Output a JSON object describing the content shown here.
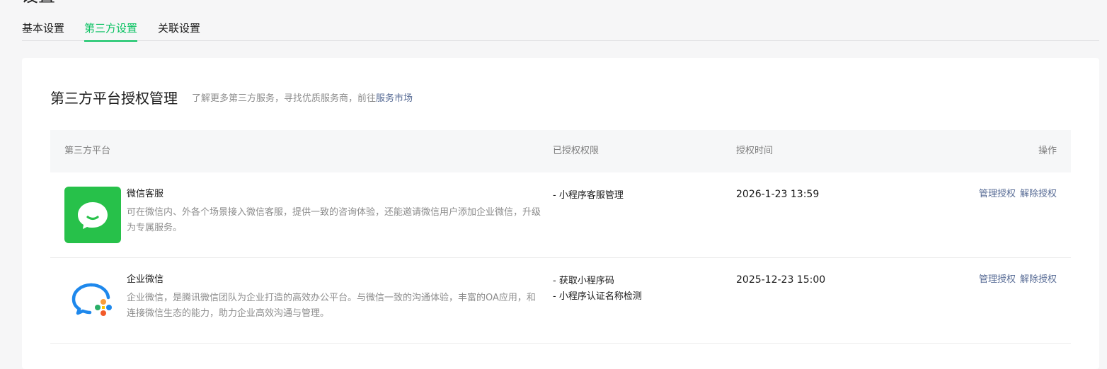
{
  "page": {
    "title": "设置"
  },
  "tabs": [
    {
      "label": "基本设置",
      "active": false
    },
    {
      "label": "第三方设置",
      "active": true
    },
    {
      "label": "关联设置",
      "active": false
    }
  ],
  "section": {
    "title": "第三方平台授权管理",
    "desc_prefix": "了解更多第三方服务，寻找优质服务商，前往",
    "desc_link": "服务市场"
  },
  "table": {
    "headers": {
      "platform": "第三方平台",
      "permissions": "已授权权限",
      "time": "授权时间",
      "action": "操作"
    },
    "rows": [
      {
        "icon": "wechat-kefu-icon",
        "name": "微信客服",
        "desc": "可在微信内、外各个场景接入微信客服，提供一致的咨询体验，还能邀请微信用户添加企业微信，升级为专属服务。",
        "permissions": [
          "- 小程序客服管理"
        ],
        "time": "2026-1-23 13:59",
        "manage": "管理授权",
        "revoke": "解除授权"
      },
      {
        "icon": "wecom-icon",
        "name": "企业微信",
        "desc": "企业微信，是腾讯微信团队为企业打造的高效办公平台。与微信一致的沟通体验，丰富的OA应用，和连接微信生态的能力，助力企业高效沟通与管理。",
        "permissions": [
          "- 获取小程序码",
          "- 小程序认证名称检测"
        ],
        "time": "2025-12-23 15:00",
        "manage": "管理授权",
        "revoke": "解除授权"
      }
    ]
  },
  "colors": {
    "accent": "#07c160",
    "link": "#576b95",
    "kefu_bg": "#27c14a"
  }
}
